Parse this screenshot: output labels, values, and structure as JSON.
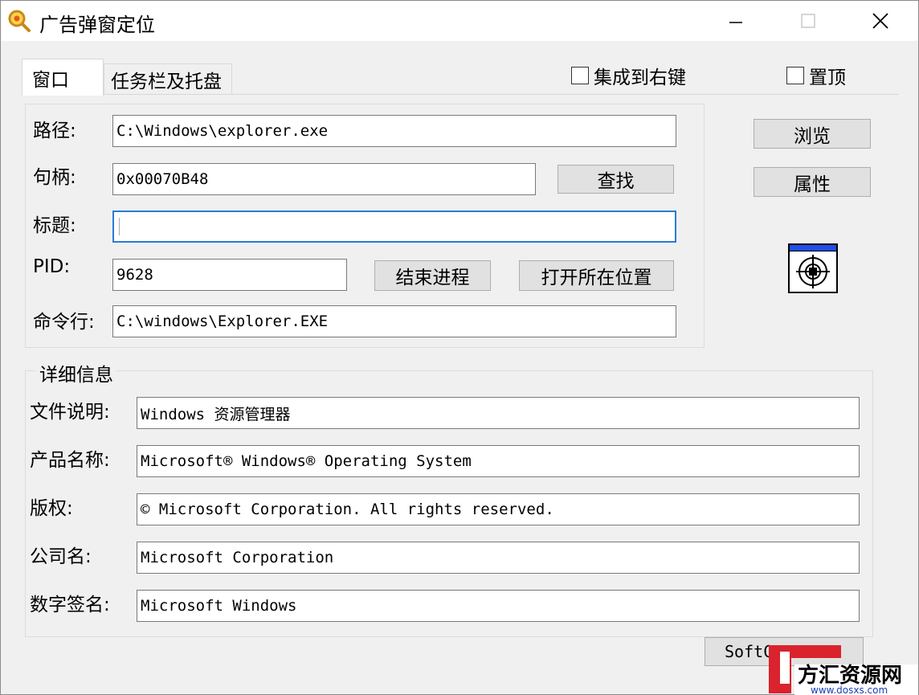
{
  "window": {
    "title": "广告弹窗定位"
  },
  "tabs": [
    "窗口",
    "任务栏及托盘"
  ],
  "checkboxes": {
    "context_menu": "集成到右键",
    "topmost": "置顶"
  },
  "window_tab": {
    "path": {
      "label": "路径:",
      "value": "C:\\Windows\\explorer.exe"
    },
    "handle": {
      "label": "句柄:",
      "value": "0x00070B48"
    },
    "title": {
      "label": "标题:",
      "value": ""
    },
    "pid": {
      "label": "PID:",
      "value": "9628"
    },
    "cmdline": {
      "label": "命令行:",
      "value": "C:\\windows\\Explorer.EXE"
    }
  },
  "buttons": {
    "browse": "浏览",
    "properties": "属性",
    "find": "查找",
    "kill": "结束进程",
    "open_location": "打开所在位置",
    "softc": "SoftC"
  },
  "details": {
    "legend": "详细信息",
    "file_desc": {
      "label": "文件说明:",
      "value": "Windows 资源管理器"
    },
    "product_name": {
      "label": "产品名称:",
      "value": "Microsoft® Windows® Operating System"
    },
    "copyright": {
      "label": "版权:",
      "value": "© Microsoft Corporation. All rights reserved."
    },
    "company": {
      "label": "公司名:",
      "value": "Microsoft Corporation"
    },
    "signature": {
      "label": "数字签名:",
      "value": "Microsoft Windows"
    }
  },
  "watermark": {
    "text": "方汇资源网",
    "url": "www.dosxs.com"
  },
  "colors": {
    "accent": "#2a7bd6",
    "watermark_red": "#d9232d"
  }
}
